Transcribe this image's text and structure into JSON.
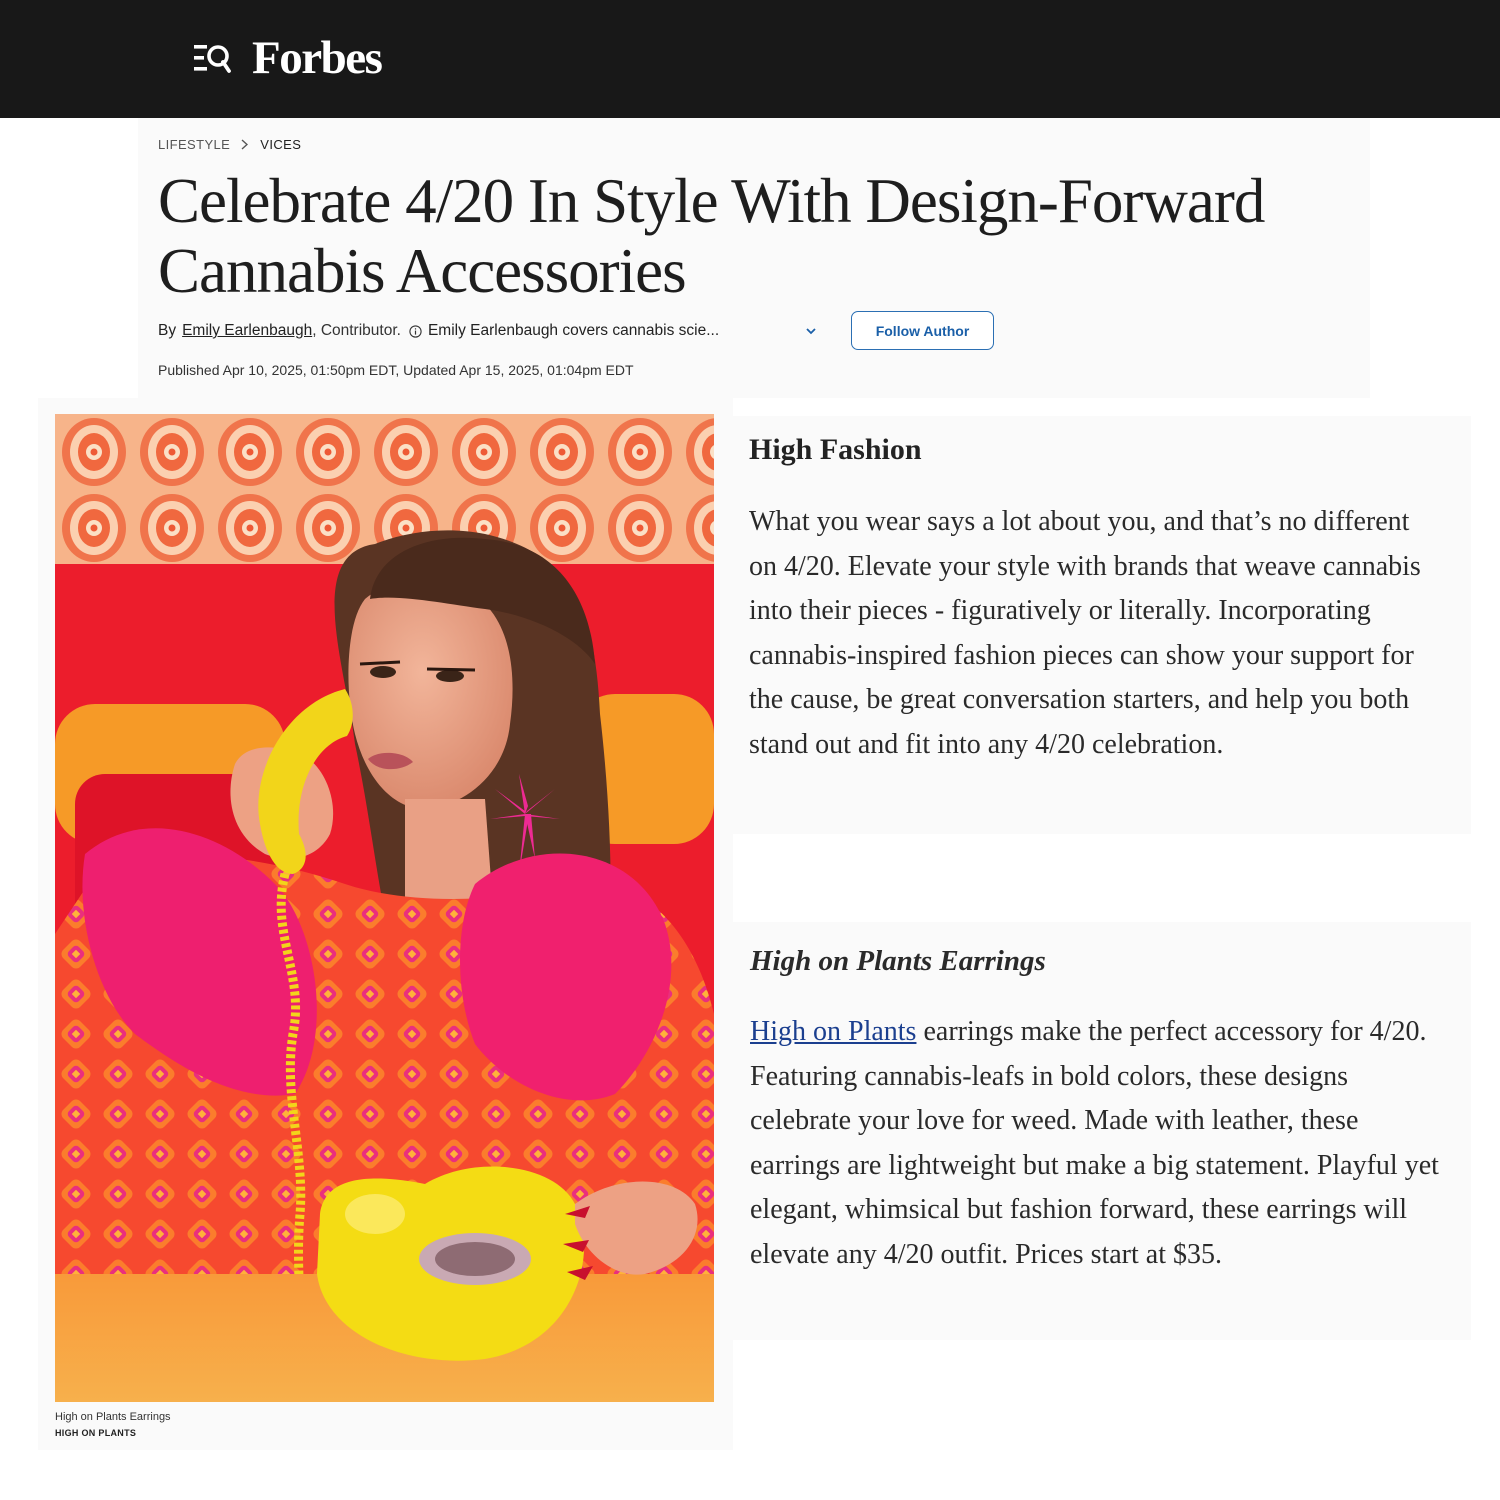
{
  "brand": {
    "logo_text": "Forbes"
  },
  "breadcrumb": [
    "LIFESTYLE",
    "VICES"
  ],
  "article": {
    "headline": "Celebrate 4/20 In Style With Design-Forward Cannabis Accessories",
    "byline": {
      "prefix": "By",
      "author": "Emily Earlenbaugh",
      "role": ", Contributor.",
      "bio": "Emily Earlenbaugh covers cannabis scie..."
    },
    "follow_label": "Follow Author",
    "published": "Published Apr 10, 2025, 01:50pm EDT, Updated Apr 15, 2025, 01:04pm EDT"
  },
  "image": {
    "caption": "High on Plants Earrings",
    "credit": "HIGH ON PLANTS"
  },
  "section": {
    "title": "High Fashion",
    "body": "What you wear says a lot about you, and that’s no different on 4/20. Elevate your style with brands that weave cannabis into their pieces - figuratively or literally. Incorporating cannabis-inspired fashion pieces can show your support for the cause, be great conversation starters, and help you both stand out and fit into any 4/20 celebration."
  },
  "product": {
    "title": "High on Plants Earrings",
    "link_text": "High on Plants",
    "body": " earrings make the perfect accessory for 4/20. Featuring cannabis-leafs in bold colors, these designs celebrate your love for weed. Made with leather, these earrings are lightweight but make a big statement. Playful yet elegant, whimsical but fashion forward, these earrings will elevate any 4/20 outfit. Prices start at $35."
  },
  "colors": {
    "topbar": "#181818",
    "link": "#1b3f8f",
    "follow_border": "#2b6fb3",
    "card_bg": "#fafafa"
  },
  "icons": [
    "menu-search-icon",
    "chevron-right-icon",
    "info-icon",
    "chevron-down-icon"
  ]
}
